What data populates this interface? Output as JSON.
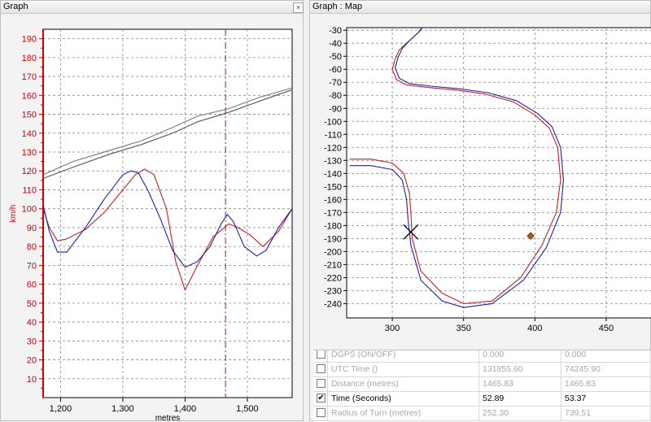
{
  "left_panel": {
    "title": "Graph",
    "close_glyph": "×"
  },
  "right_panel": {
    "title": "Graph : Map"
  },
  "colors": {
    "red_trace": "#cc1f1f",
    "blue_trace": "#1f1fb0",
    "axis_red": "#cc0000",
    "marker": "#b05a10"
  },
  "chart_data": [
    {
      "type": "line",
      "xlabel": "metres",
      "ylabel": "km/h",
      "xlim": [
        1172,
        1572
      ],
      "ylim": [
        0,
        195
      ],
      "x_ticks": [
        1200,
        1300,
        1400,
        1500
      ],
      "x_tick_labels": [
        "1,200",
        "1,300",
        "1,400",
        "1,500"
      ],
      "y_ticks": [
        10,
        20,
        30,
        40,
        50,
        60,
        70,
        80,
        90,
        100,
        110,
        120,
        130,
        140,
        150,
        160,
        170,
        180,
        190
      ],
      "cursor_x": 1465,
      "grid": true,
      "series": [
        {
          "color": "#555555",
          "x": [
            1172,
            1220,
            1280,
            1330,
            1380,
            1420,
            1470,
            1520,
            1572
          ],
          "y": [
            116,
            122,
            129,
            134,
            140,
            146,
            151,
            157,
            163
          ]
        },
        {
          "color": "#777777",
          "x": [
            1172,
            1220,
            1280,
            1330,
            1380,
            1420,
            1470,
            1520,
            1572
          ],
          "y": [
            118,
            125,
            131,
            136,
            143,
            149,
            153,
            159,
            164
          ]
        },
        {
          "color": "#cc1f1f",
          "x": [
            1172,
            1182,
            1195,
            1210,
            1240,
            1270,
            1300,
            1320,
            1335,
            1350,
            1370,
            1385,
            1400,
            1420,
            1445,
            1470,
            1485,
            1505,
            1525,
            1550,
            1572
          ],
          "y": [
            100,
            90,
            83,
            84,
            89,
            98,
            110,
            118,
            121,
            118,
            100,
            72,
            57,
            70,
            85,
            92,
            90,
            86,
            80,
            88,
            100
          ]
        },
        {
          "color": "#1f1fb0",
          "x": [
            1172,
            1182,
            1195,
            1210,
            1240,
            1270,
            1300,
            1313,
            1325,
            1340,
            1360,
            1380,
            1400,
            1420,
            1440,
            1458,
            1468,
            1478,
            1495,
            1515,
            1530,
            1550,
            1572
          ],
          "y": [
            102,
            88,
            77,
            77,
            90,
            105,
            118,
            120,
            119,
            110,
            95,
            78,
            69,
            72,
            80,
            92,
            97,
            93,
            80,
            75,
            78,
            90,
            100
          ]
        }
      ]
    },
    {
      "type": "line",
      "xlim": [
        268,
        482
      ],
      "ylim": [
        -251,
        -28
      ],
      "x_ticks": [
        300,
        350,
        400,
        450
      ],
      "y_ticks": [
        -30,
        -40,
        -50,
        -60,
        -70,
        -80,
        -90,
        -100,
        -110,
        -120,
        -130,
        -140,
        -150,
        -160,
        -170,
        -180,
        -190,
        -200,
        -210,
        -220,
        -230,
        -240
      ],
      "grid": true,
      "series": [
        {
          "color": "#cc1f1f",
          "x": [
            270,
            285,
            300,
            308,
            312,
            313,
            314,
            320,
            335,
            350,
            370,
            390,
            405,
            415,
            418,
            416,
            410,
            400,
            385,
            365,
            345,
            325,
            310,
            303,
            300,
            302,
            305,
            312,
            318,
            320,
            330,
            345,
            370,
            395,
            408,
            410,
            400,
            385,
            370,
            355,
            340,
            332
          ],
          "x_fix": true,
          "y": [
            -129,
            -129,
            -132,
            -140,
            -155,
            -170,
            -190,
            -215,
            -232,
            -240,
            -238,
            -220,
            -195,
            -170,
            -145,
            -120,
            -105,
            -95,
            -85,
            -79,
            -76,
            -74,
            -72,
            -68,
            -60,
            -52,
            -45,
            -38,
            -32,
            -29,
            -30,
            -30,
            -30,
            -30,
            -30,
            -30,
            -30,
            -30,
            -30,
            -30,
            -30,
            -30
          ]
        },
        {
          "color": "#1f1fb0",
          "x": [
            270,
            285,
            300,
            307,
            310,
            311,
            313,
            320,
            335,
            350,
            370,
            392,
            408,
            418,
            420,
            418,
            412,
            402,
            387,
            367,
            347,
            327,
            312,
            305,
            302,
            304,
            307,
            313,
            319,
            321
          ],
          "y": [
            -134,
            -134,
            -137,
            -145,
            -160,
            -175,
            -195,
            -222,
            -238,
            -243,
            -240,
            -222,
            -197,
            -170,
            -145,
            -120,
            -104,
            -94,
            -84,
            -78,
            -75,
            -73,
            -71,
            -67,
            -59,
            -51,
            -44,
            -37,
            -31,
            -28
          ]
        }
      ],
      "marker_x": 313,
      "marker_y": -185,
      "point_x": 397,
      "point_y": -188
    }
  ],
  "table": {
    "rows": [
      {
        "checked": false,
        "label": "DGPS (ON/OFF)",
        "v1": "0.000",
        "v2": "0.000",
        "dim": true
      },
      {
        "checked": false,
        "label": "UTC Time ()",
        "v1": "131855.60",
        "v2": "74245.90",
        "dim": true
      },
      {
        "checked": false,
        "label": "Distance (metres)",
        "v1": "1465.83",
        "v2": "1465.83",
        "dim": true
      },
      {
        "checked": true,
        "label": "Time (Seconds)",
        "v1": "52.89",
        "v2": "53.37",
        "dim": false
      },
      {
        "checked": false,
        "label": "Radius of Turn (metres)",
        "v1": "252.30",
        "v2": "739.51",
        "dim": true
      }
    ],
    "check_glyph": "✔"
  }
}
